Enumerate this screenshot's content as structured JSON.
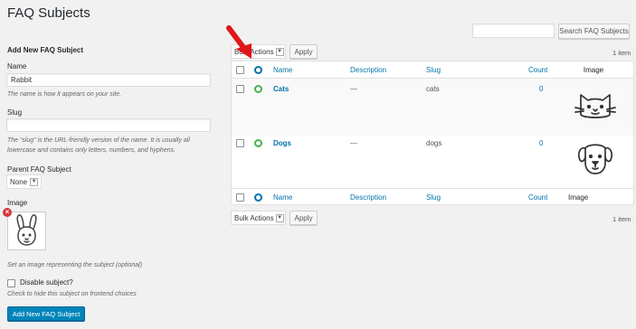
{
  "page_title": "FAQ Subjects",
  "search": {
    "button_label": "Search FAQ Subjects"
  },
  "form": {
    "heading": "Add New FAQ Subject",
    "name_label": "Name",
    "name_value": "Rabbit",
    "name_desc": "The name is how it appears on your site.",
    "slug_label": "Slug",
    "slug_value": "",
    "slug_desc_1": "The “slug” is the URL-friendly version of the name. It is usually all",
    "slug_desc_2": "lowercase and contains only letters, numbers, and hyphens.",
    "parent_label": "Parent FAQ Subject",
    "parent_value": "None",
    "image_label": "Image",
    "image_icon": "rabbit-icon",
    "image_desc": "Set an image representing the subject (optional)",
    "disable_label": "Disable subject?",
    "disable_desc": "Check to hide this subject on frontend choices",
    "submit_label": "Add New FAQ Subject"
  },
  "bulk": {
    "top_value": "Bulk Actions",
    "bottom_value": "Bulk Actions",
    "apply_label": "Apply",
    "items_count": "1 item"
  },
  "table": {
    "headers": {
      "name": "Name",
      "description": "Description",
      "slug": "Slug",
      "count": "Count",
      "image": "Image"
    },
    "rows": [
      {
        "name": "Cats",
        "description": "—",
        "slug": "cats",
        "count": "0",
        "image_icon": "cat-icon"
      },
      {
        "name": "Dogs",
        "description": "—",
        "slug": "dogs",
        "count": "0",
        "image_icon": "dog-icon"
      }
    ]
  },
  "colors": {
    "primary": "#0085ba",
    "link": "#0073aa",
    "status_green": "#46b450",
    "annotation_arrow": "#e0161b"
  }
}
